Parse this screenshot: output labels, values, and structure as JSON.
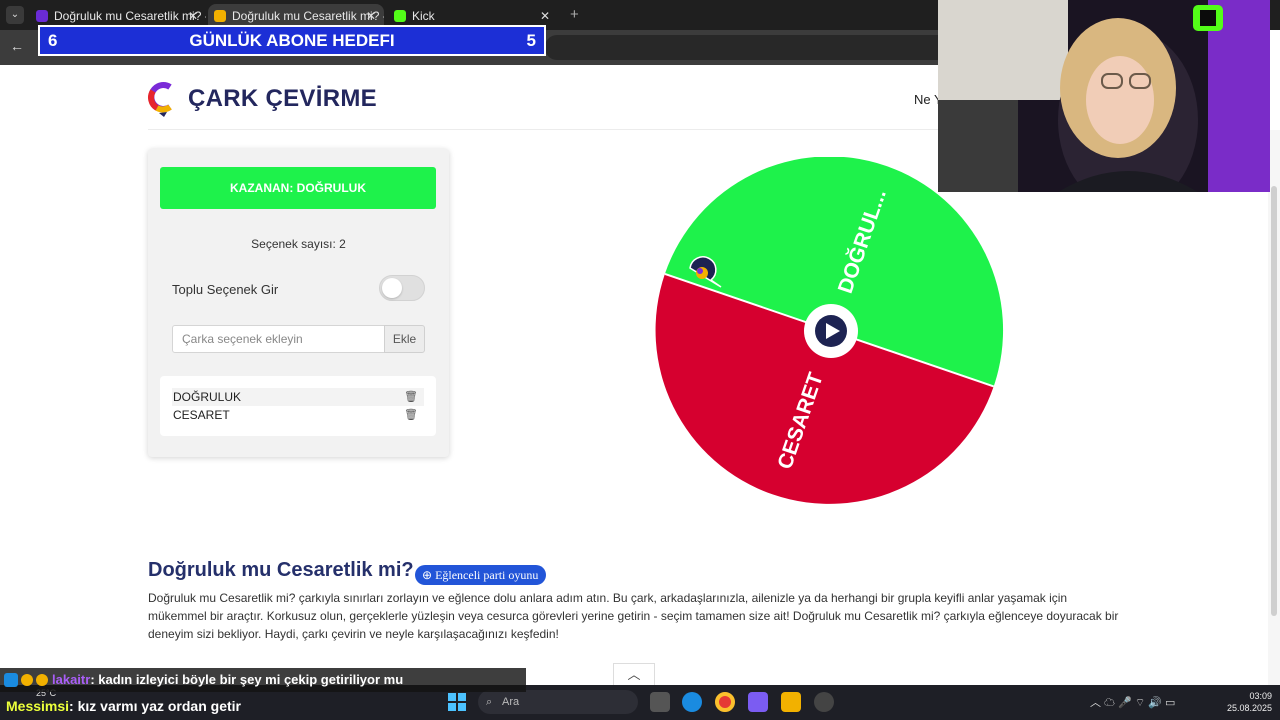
{
  "browser": {
    "tabs": [
      {
        "title": "Doğruluk mu Cesaretlik mi? - Ç",
        "active": false
      },
      {
        "title": "Doğruluk mu Cesaretlik mi? - Ç",
        "active": true
      },
      {
        "title": "Kick",
        "active": false
      }
    ]
  },
  "goal": {
    "left_value": "6",
    "title": "GÜNLÜK ABONE HEDEFI",
    "right_value": "5"
  },
  "site": {
    "logo_text": "ÇARK ÇEVİRME",
    "nav_peek": "Ne Y"
  },
  "panel": {
    "winner_label": "KAZANAN: DOĞRULUK",
    "option_count_label": "Seçenek sayısı: 2",
    "bulk_label": "Toplu Seçenek Gir",
    "bulk_enabled": false,
    "input_placeholder": "Çarka seçenek ekleyin",
    "add_button": "Ekle",
    "options": [
      "DOĞRULUK",
      "CESARET"
    ]
  },
  "wheel": {
    "segments": [
      {
        "label": "DOĞRUL...",
        "color": "#1ef24b"
      },
      {
        "label": "CESARET",
        "color": "#d6002f"
      }
    ],
    "play_icon": "play-icon"
  },
  "article": {
    "title": "Doğruluk mu Cesaretlik mi?",
    "badge": "Eğlenceli parti oyunu",
    "body": "Doğruluk mu Cesaretlik mi? çarkıyla sınırları zorlayın ve eğlence dolu anlara adım atın. Bu çark, arkadaşlarınızla, ailenizle ya da herhangi bir grupla keyifli anlar yaşamak için mükemmel bir araçtır. Korkusuz olun, gerçeklerle yüzleşin veya cesurca görevleri yerine getirin - seçim tamamen size ait! Doğruluk mu Cesaretlik mi? çarkıyla eğlenceye doyuracak bir deneyim sizi bekliyor. Haydi, çarkı çevirin ve neyle karşılaşacağınızı keşfedin!"
  },
  "chat": [
    {
      "user": "lakaitr",
      "message": ": kadın izleyici böyle bir şey mi çekip getiriliyor mu"
    },
    {
      "user": "Messimsi",
      "message": ": kız varmı yaz ordan getir"
    }
  ],
  "taskbar": {
    "search_placeholder": "Ara",
    "weather": "25°C",
    "time": "03:09",
    "date": "25.08.2025"
  },
  "colors": {
    "accent_green": "#1ef24b",
    "accent_red": "#d6002f",
    "navy": "#23275e",
    "goal_blue": "#1c2fd6"
  }
}
